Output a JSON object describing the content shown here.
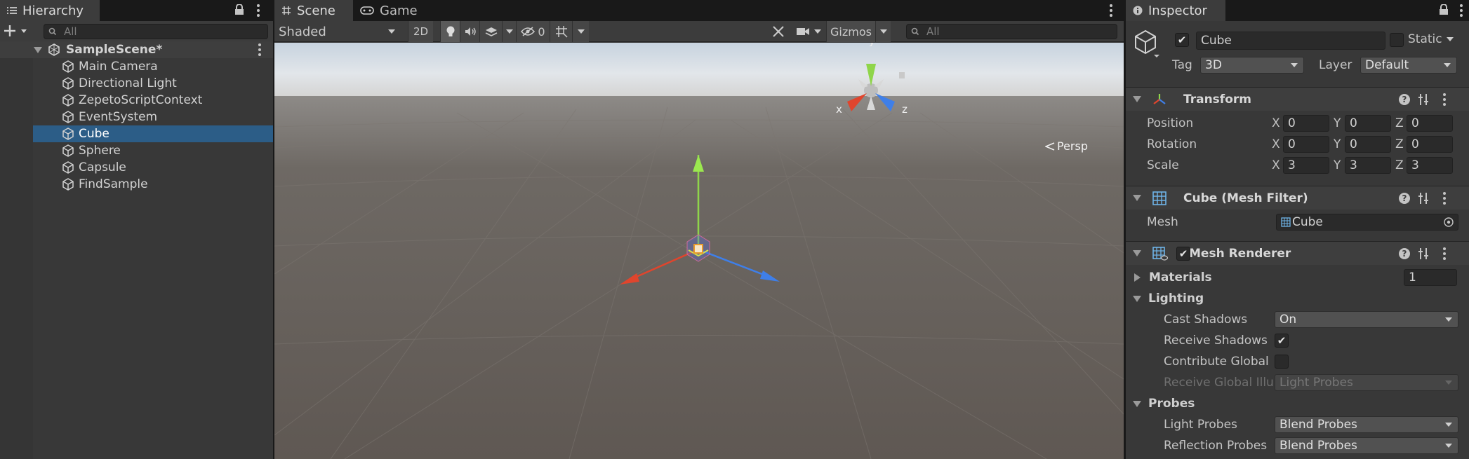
{
  "hierarchy": {
    "tab_label": "Hierarchy",
    "search_placeholder": "All",
    "scene_name": "SampleScene*",
    "items": [
      {
        "label": "Main Camera"
      },
      {
        "label": "Directional Light"
      },
      {
        "label": "ZepetoScriptContext"
      },
      {
        "label": "EventSystem"
      },
      {
        "label": "Cube",
        "selected": true
      },
      {
        "label": "Sphere"
      },
      {
        "label": "Capsule"
      },
      {
        "label": "FindSample"
      }
    ]
  },
  "scene_view": {
    "tabs": [
      {
        "label": "Scene",
        "active": true
      },
      {
        "label": "Game",
        "active": false
      }
    ],
    "shading_mode": "Shaded",
    "mode_2d_label": "2D",
    "hidden_count": "0",
    "gizmos_label": "Gizmos",
    "search_placeholder": "All",
    "projection_label": "Persp",
    "orientation_axes": {
      "x": "x",
      "y": "y",
      "z": "z"
    }
  },
  "inspector": {
    "tab_label": "Inspector",
    "object_active": true,
    "object_name": "Cube",
    "static_label": "Static",
    "tag_label": "Tag",
    "tag_value": "3D",
    "layer_label": "Layer",
    "layer_value": "Default",
    "transform": {
      "title": "Transform",
      "rows": [
        {
          "label": "Position",
          "x": "0",
          "y": "0",
          "z": "0"
        },
        {
          "label": "Rotation",
          "x": "0",
          "y": "0",
          "z": "0"
        },
        {
          "label": "Scale",
          "x": "3",
          "y": "3",
          "z": "3"
        }
      ],
      "axis_labels": {
        "x": "X",
        "y": "Y",
        "z": "Z"
      }
    },
    "mesh_filter": {
      "title": "Cube (Mesh Filter)",
      "mesh_label": "Mesh",
      "mesh_value": "Cube"
    },
    "mesh_renderer": {
      "title": "Mesh Renderer",
      "enabled": true,
      "materials_label": "Materials",
      "materials_count": "1",
      "lighting_label": "Lighting",
      "cast_shadows_label": "Cast Shadows",
      "cast_shadows_value": "On",
      "receive_shadows_label": "Receive Shadows",
      "receive_shadows": true,
      "contribute_gi_label": "Contribute Global",
      "contribute_gi": false,
      "receive_gi_label": "Receive Global Illu",
      "receive_gi_value": "Light Probes",
      "probes_label": "Probes",
      "light_probes_label": "Light Probes",
      "light_probes_value": "Blend Probes",
      "reflection_probes_label": "Reflection Probes",
      "reflection_probes_value": "Blend Probes"
    }
  },
  "colors": {
    "selection": "#2c5d87",
    "axis_x": "#e0452d",
    "axis_y": "#8fd54a",
    "axis_z": "#3f7fe8"
  }
}
